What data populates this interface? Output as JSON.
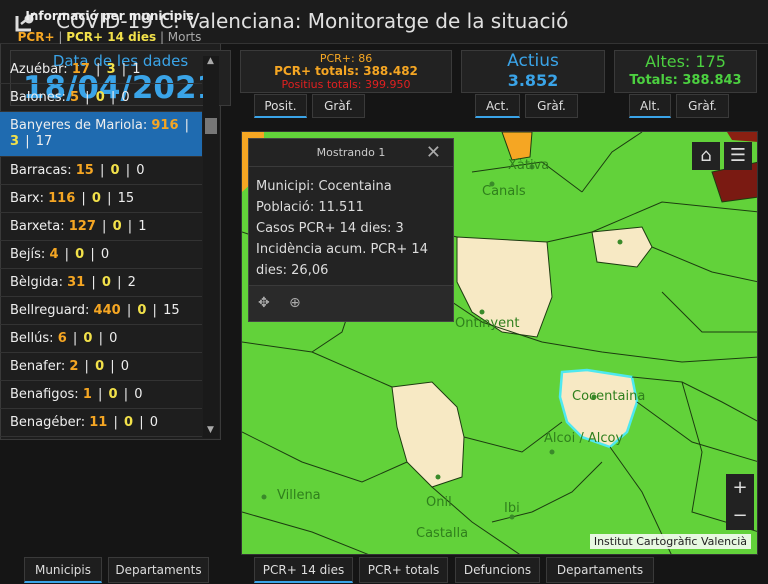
{
  "header": {
    "title": "COVID-19 C. Valenciana: Monitoratge de la situació"
  },
  "date_panel": {
    "label": "Data de les dades",
    "value": "18/04/2021"
  },
  "pcr_panel": {
    "pcr": "PCR+: 86",
    "pcr_total": "PCR+ totals: 388.482",
    "positius_totals": "Positius totals: 399.950"
  },
  "pcr_tabs": [
    "Posit.",
    "Gràf."
  ],
  "actius_panel": {
    "label": "Actius",
    "value": "3.852"
  },
  "actius_tabs": [
    "Act.",
    "Gràf."
  ],
  "altes_panel": {
    "label": "Altes: 175",
    "value": "Totals: 388.843"
  },
  "altes_tabs": [
    "Alt.",
    "Gràf."
  ],
  "list_panel": {
    "title": "Informació per municipis",
    "legend": {
      "a": "PCR+",
      "sep1": " | ",
      "b": "PCR+ 14 dies",
      "sep2": " | ",
      "c": "Morts"
    }
  },
  "municipis": [
    {
      "name": "Azuébar:",
      "pcr": "17",
      "pcr14": "3",
      "morts": "1"
    },
    {
      "name": "Balones:",
      "pcr": "5",
      "pcr14": "0",
      "morts": "0"
    },
    {
      "name": "Banyeres de Mariola:",
      "pcr": "916",
      "pcr14": "3",
      "morts": "17",
      "selected": true
    },
    {
      "name": "Barracas:",
      "pcr": "15",
      "pcr14": "0",
      "morts": "0"
    },
    {
      "name": "Barx:",
      "pcr": "116",
      "pcr14": "0",
      "morts": "15"
    },
    {
      "name": "Barxeta:",
      "pcr": "127",
      "pcr14": "0",
      "morts": "1"
    },
    {
      "name": "Bejís:",
      "pcr": "4",
      "pcr14": "0",
      "morts": "0"
    },
    {
      "name": "Bèlgida:",
      "pcr": "31",
      "pcr14": "0",
      "morts": "2"
    },
    {
      "name": "Bellreguard:",
      "pcr": "440",
      "pcr14": "0",
      "morts": "15"
    },
    {
      "name": "Bellús:",
      "pcr": "6",
      "pcr14": "0",
      "morts": "0"
    },
    {
      "name": "Benafer:",
      "pcr": "2",
      "pcr14": "0",
      "morts": "0"
    },
    {
      "name": "Benafigos:",
      "pcr": "1",
      "pcr14": "0",
      "morts": "0"
    },
    {
      "name": "Benagéber:",
      "pcr": "11",
      "pcr14": "0",
      "morts": "0"
    }
  ],
  "popup": {
    "title": "Mostrando 1",
    "lines": [
      "Municipi: Cocentaina",
      "Població: 11.511",
      "Casos PCR+ 14 dies: 3",
      "Incidència acum. PCR+ 14 dies: 26,06"
    ]
  },
  "map": {
    "places": [
      "Xàtiva",
      "Canals",
      "Ontinyent",
      "Cocentaina",
      "Alcoi / Alcoy",
      "Villena",
      "Onil",
      "Ibi",
      "Castalla"
    ],
    "attribution": "Institut Cartogràfic Valencià"
  },
  "bottom_tabs_left": [
    "Municipis",
    "Departaments"
  ],
  "bottom_tabs_right": [
    "PCR+ 14 dies",
    "PCR+ totals",
    "Defuncions",
    "Departaments"
  ],
  "colors": {
    "accent": "#3aa4e8",
    "pcr": "#f5a623",
    "pcr14": "#f2e14a",
    "altes": "#4cd040",
    "map_green": "#62d23a"
  }
}
